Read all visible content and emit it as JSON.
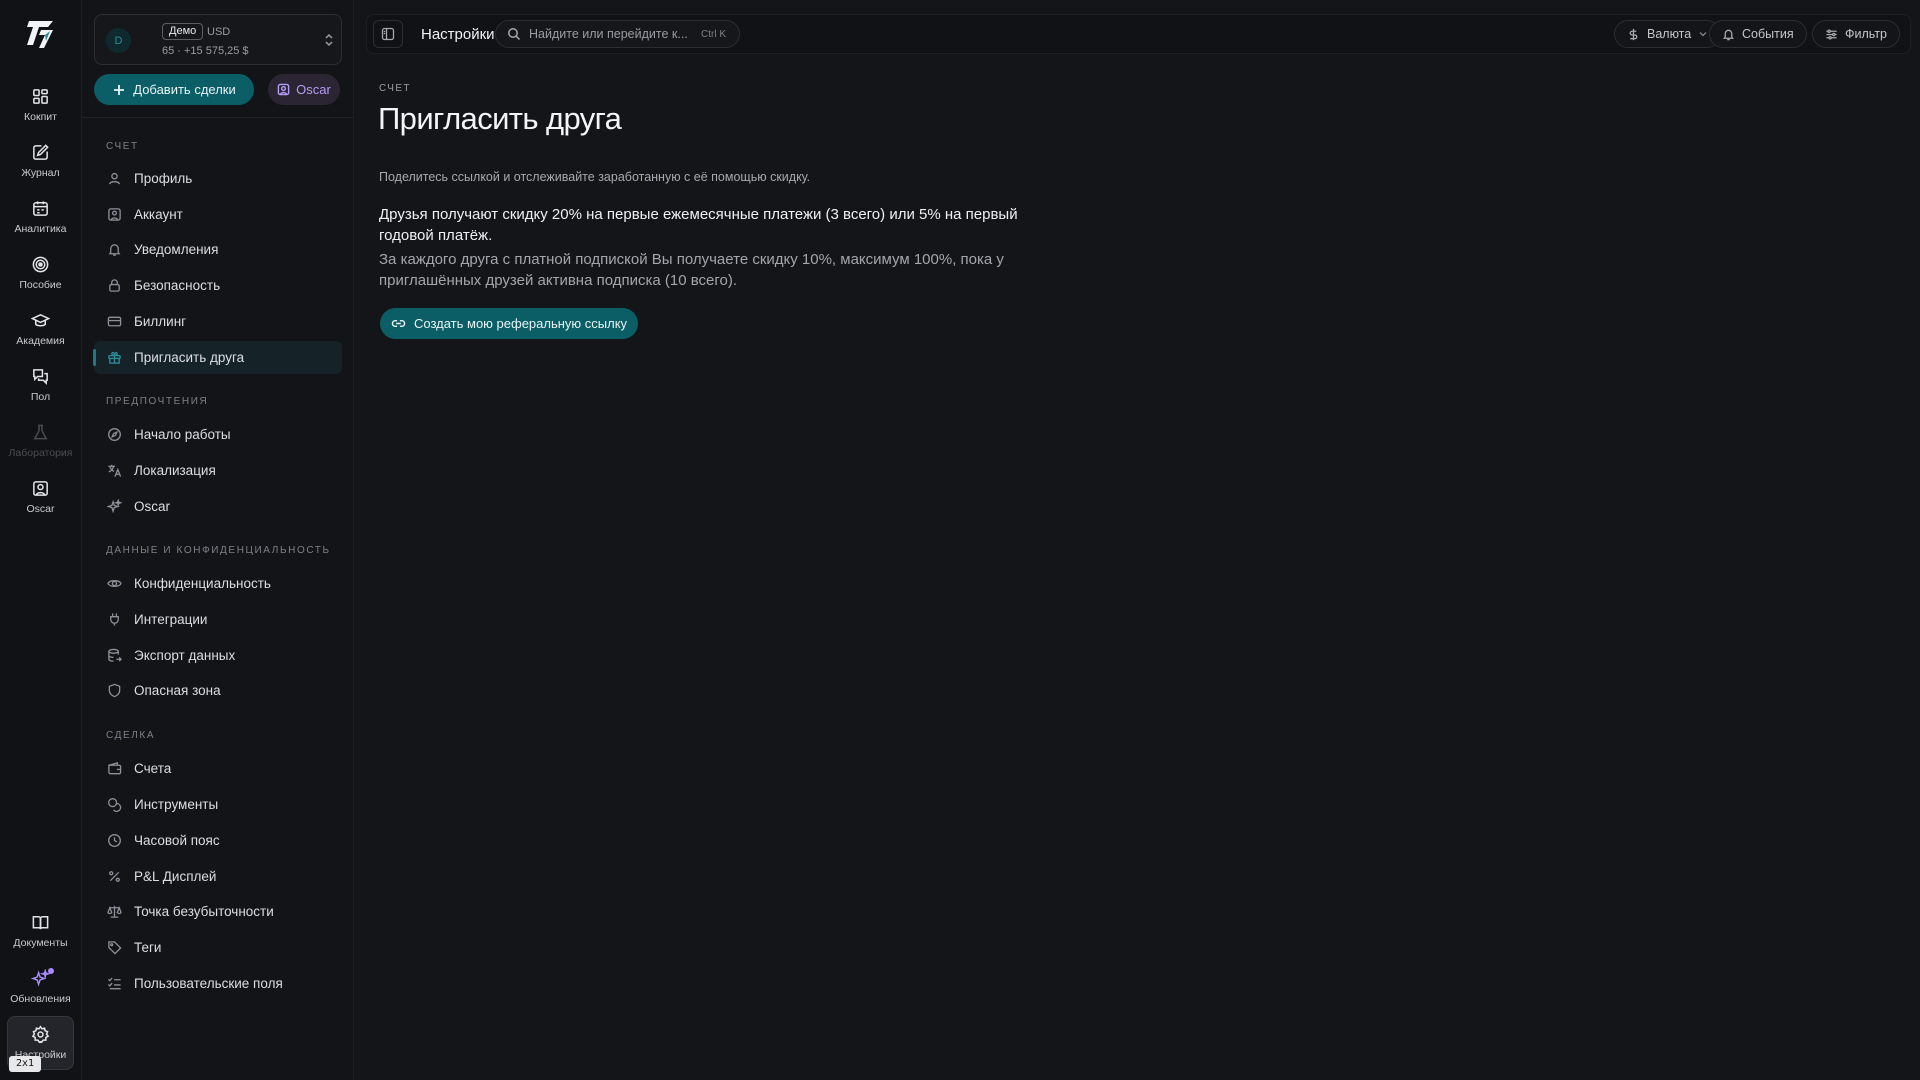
{
  "rail": {
    "items": [
      {
        "label": "Кокпит",
        "icon": "dashboard-grid-icon"
      },
      {
        "label": "Журнал",
        "icon": "journal-edit-icon"
      },
      {
        "label": "Аналитика",
        "icon": "calendar-analytics-icon"
      },
      {
        "label": "Пособие",
        "icon": "target-icon"
      },
      {
        "label": "Академия",
        "icon": "graduation-cap-icon"
      },
      {
        "label": "Пол",
        "icon": "chat-bubbles-icon"
      },
      {
        "label": "Лаборатория",
        "icon": "flask-icon"
      },
      {
        "label": "Oscar",
        "icon": "oscar-portrait-icon"
      },
      {
        "label": "Документы",
        "icon": "book-open-icon"
      },
      {
        "label": "Обновления",
        "icon": "sparkles-icon"
      },
      {
        "label": "Настройки",
        "icon": "gear-icon"
      }
    ],
    "shortcut_badge": "2x1"
  },
  "account": {
    "avatar_letter": "D",
    "badge": "Демо",
    "currency": "USD",
    "summary": "65 · +15 575,25 $"
  },
  "actions": {
    "add_trades": "Добавить сделки",
    "oscar": "Oscar"
  },
  "sections": {
    "account": {
      "title": "Счет",
      "items": [
        "Профиль",
        "Аккаунт",
        "Уведомления",
        "Безопасность",
        "Биллинг",
        "Пригласить друга"
      ]
    },
    "preferences": {
      "title": "Предпочтения",
      "items": [
        "Начало работы",
        "Локализация",
        "Oscar"
      ]
    },
    "data": {
      "title": "Данные и конфиденциальность",
      "items": [
        "Конфиденциальность",
        "Интеграции",
        "Экспорт данных",
        "Опасная зона"
      ]
    },
    "trade": {
      "title": "Сделка",
      "items": [
        "Счета",
        "Инструменты",
        "Часовой пояс",
        "P&L Дисплей",
        "Точка безубыточности",
        "Теги",
        "Пользовательские поля"
      ]
    }
  },
  "topbar": {
    "title": "Настройки",
    "search_placeholder": "Найдите или перейдите к...",
    "search_shortcut": "Ctrl K",
    "currency": "Валюта",
    "events": "События",
    "filter": "Фильтр"
  },
  "page": {
    "breadcrumb": "Счет",
    "title": "Пригласить друга",
    "lead": "Поделитесь ссылкой и отслеживайте заработанную с её помощью скидку.",
    "paragraph1": "Друзья получают скидку 20% на первые ежемесячные платежи (3 всего) или 5% на первый годовой платёж.",
    "paragraph2": "За каждого друга с платной подпиской Вы получаете скидку 10%, максимум 100%, пока у приглашённых друзей активна подписка (10 всего).",
    "cta": "Создать мою реферальную ссылку"
  },
  "colors": {
    "accent": "#0b5e66",
    "accent_text": "#2b8e98",
    "oscar_purple": "#b59cf5",
    "background": "#141518"
  }
}
